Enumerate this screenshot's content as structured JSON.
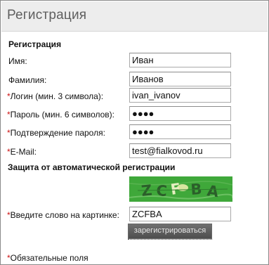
{
  "header": {
    "title": "Регистрация"
  },
  "form": {
    "section_title": "Регистрация",
    "required_mark": "*",
    "name": {
      "label": "Имя:",
      "value": "Иван"
    },
    "surname": {
      "label": "Фамилия:",
      "value": "Иванов"
    },
    "login": {
      "label": "Логин (мин. 3 символа):",
      "value": "ivan_ivanov"
    },
    "password": {
      "label": "Пароль (мин. 6 символов):",
      "value": "●●●●"
    },
    "password_confirm": {
      "label": "Подтверждение пароля:",
      "value": "●●●●"
    },
    "email": {
      "label": "E-Mail:",
      "value": "test@fialkovod.ru"
    },
    "protection_title": "Защита от автоматической регистрации",
    "captcha": {
      "image_text": "ZCFBA",
      "label": "Введите слово на картинке:",
      "value": "ZCFBA"
    },
    "submit_label": "зарегистрироваться",
    "required_note": "Обязательные поля"
  },
  "colors": {
    "required": "#cc1111",
    "captcha_bg": "#3fa83a",
    "button_bg": "#5a5a5a"
  }
}
